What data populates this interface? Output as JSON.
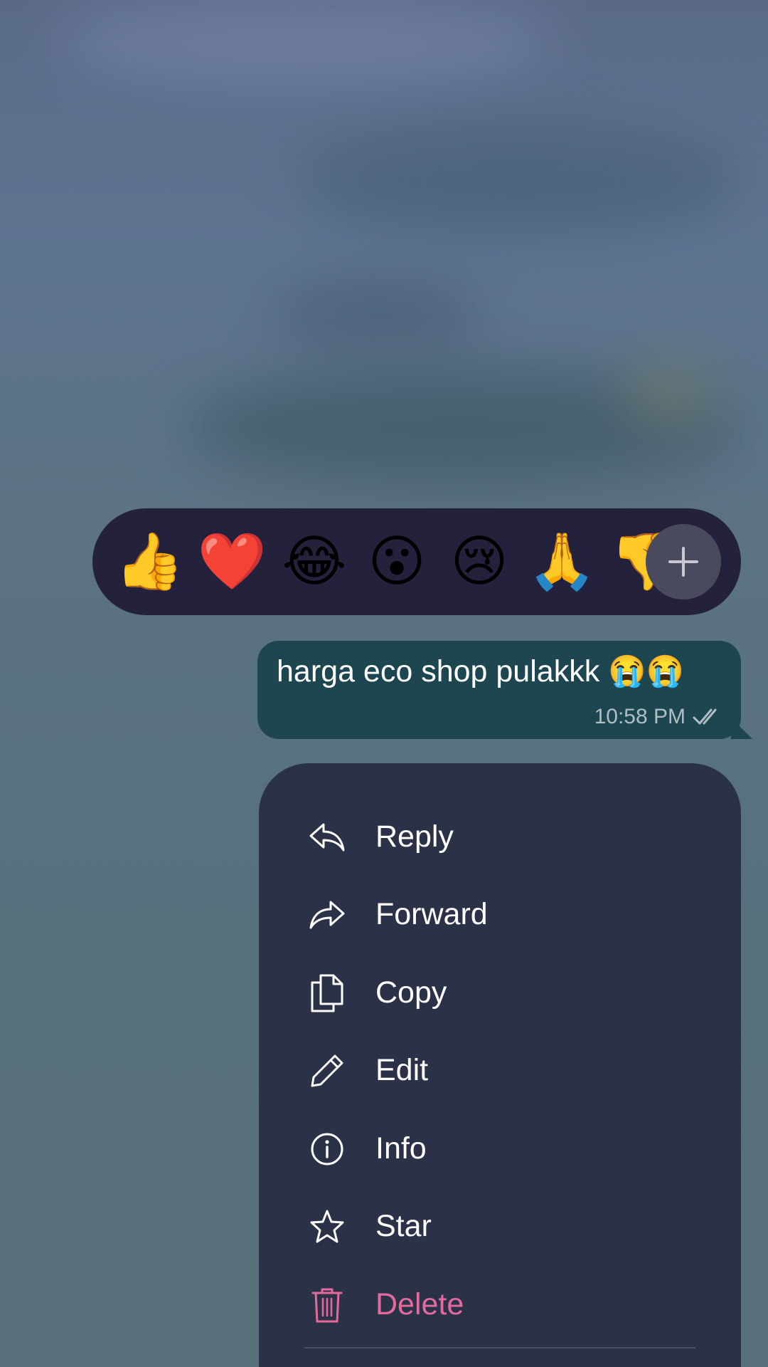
{
  "reactions": [
    {
      "emoji": "👍",
      "name": "thumbs-up"
    },
    {
      "emoji": "❤️",
      "name": "red-heart"
    },
    {
      "emoji": "😂",
      "name": "tears-of-joy"
    },
    {
      "emoji": "😮",
      "name": "surprised-face"
    },
    {
      "emoji": "😢",
      "name": "crying-face"
    },
    {
      "emoji": "🙏",
      "name": "folded-hands"
    },
    {
      "emoji": "👎",
      "name": "thumbs-down"
    }
  ],
  "message": {
    "text": "harga eco shop pulakkk 😭😭",
    "time": "10:58 PM",
    "status_icon": "double-check-icon"
  },
  "menu": {
    "items": [
      {
        "label": "Reply",
        "icon": "reply-icon"
      },
      {
        "label": "Forward",
        "icon": "forward-icon"
      },
      {
        "label": "Copy",
        "icon": "copy-icon"
      },
      {
        "label": "Edit",
        "icon": "pencil-icon"
      },
      {
        "label": "Info",
        "icon": "info-icon"
      },
      {
        "label": "Star",
        "icon": "star-icon"
      },
      {
        "label": "Delete",
        "icon": "trash-icon"
      }
    ]
  },
  "colors": {
    "reaction_bar": "#24213d",
    "bubble": "#1d4650",
    "menu": "#2b3248",
    "danger": "#e36a9a"
  }
}
